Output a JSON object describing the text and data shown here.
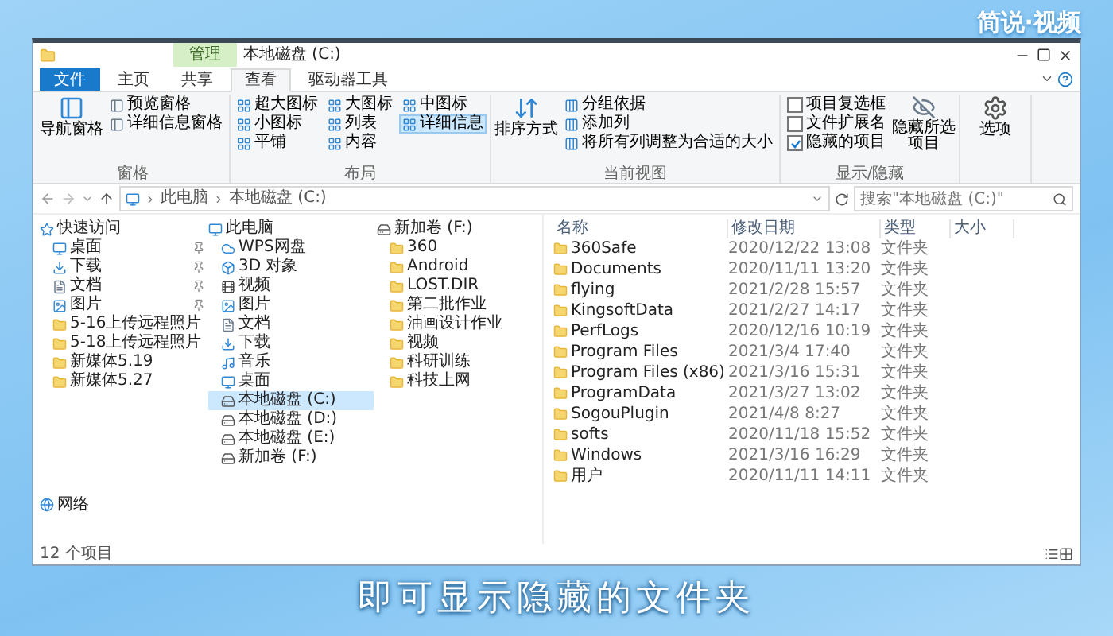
{
  "brand": {
    "logo": "简说·视频"
  },
  "window": {
    "title": "本地磁盘 (C:)",
    "context_tab": "管理"
  },
  "tabs": [
    {
      "label": "文件",
      "kind": "file",
      "selected": false
    },
    {
      "label": "主页",
      "kind": "tab",
      "selected": false
    },
    {
      "label": "共享",
      "kind": "tab",
      "selected": false
    },
    {
      "label": "查看",
      "kind": "tab",
      "selected": true
    },
    {
      "label": "驱动器工具",
      "kind": "tab",
      "selected": false
    }
  ],
  "ribbon": {
    "groups": [
      {
        "label": "窗格",
        "items": [
          {
            "label": "导航窗格",
            "kind": "large"
          },
          {
            "label": "预览窗格",
            "kind": "small"
          },
          {
            "label": "详细信息窗格",
            "kind": "small"
          }
        ]
      },
      {
        "label": "布局",
        "items": [
          {
            "label": "超大图标",
            "kind": "view",
            "selected": false
          },
          {
            "label": "小图标",
            "kind": "view",
            "selected": false
          },
          {
            "label": "平铺",
            "kind": "view",
            "selected": false
          },
          {
            "label": "大图标",
            "kind": "view",
            "selected": false
          },
          {
            "label": "列表",
            "kind": "view",
            "selected": false
          },
          {
            "label": "内容",
            "kind": "view",
            "selected": false
          },
          {
            "label": "中图标",
            "kind": "view",
            "selected": false
          },
          {
            "label": "详细信息",
            "kind": "view",
            "selected": true
          }
        ]
      },
      {
        "label": "当前视图",
        "items": [
          {
            "label": "排序方式",
            "kind": "large"
          },
          {
            "label": "分组依据",
            "kind": "small"
          },
          {
            "label": "添加列",
            "kind": "small"
          },
          {
            "label": "将所有列调整为合适的大小",
            "kind": "small"
          }
        ]
      },
      {
        "label": "显示/隐藏",
        "items": [
          {
            "label": "项目复选框",
            "kind": "check",
            "checked": false
          },
          {
            "label": "文件扩展名",
            "kind": "check",
            "checked": false
          },
          {
            "label": "隐藏的项目",
            "kind": "check",
            "checked": true
          },
          {
            "label": "隐藏所选项目",
            "kind": "large"
          }
        ]
      },
      {
        "items": [
          {
            "label": "选项",
            "kind": "large"
          }
        ]
      }
    ]
  },
  "address": {
    "path": [
      "此电脑",
      "本地磁盘 (C:)"
    ],
    "search_placeholder": "搜索\"本地磁盘 (C:)\""
  },
  "navigation": [
    {
      "label": "快速访问",
      "kind": "star",
      "selected": false,
      "children": [
        {
          "label": "桌面",
          "kind": "desktop",
          "pinned": true,
          "selected": false
        },
        {
          "label": "下载",
          "kind": "download",
          "pinned": true,
          "selected": false
        },
        {
          "label": "文档",
          "kind": "doc",
          "pinned": true,
          "selected": false
        },
        {
          "label": "图片",
          "kind": "picture",
          "pinned": true,
          "selected": false
        },
        {
          "label": "5-16上传远程照片",
          "kind": "folder",
          "pinned": false,
          "selected": false
        },
        {
          "label": "5-18上传远程照片",
          "kind": "folder",
          "pinned": false,
          "selected": false
        },
        {
          "label": "新媒体5.19",
          "kind": "folder",
          "pinned": false,
          "selected": false
        },
        {
          "label": "新媒体5.27",
          "kind": "folder",
          "pinned": false,
          "selected": false
        }
      ]
    },
    {
      "label": "此电脑",
      "kind": "pc",
      "selected": false,
      "children": [
        {
          "label": "WPS网盘",
          "kind": "cloud",
          "pinned": false,
          "selected": false
        },
        {
          "label": "3D 对象",
          "kind": "cube",
          "pinned": false,
          "selected": false
        },
        {
          "label": "视频",
          "kind": "video",
          "pinned": false,
          "selected": false
        },
        {
          "label": "图片",
          "kind": "picture",
          "pinned": false,
          "selected": false
        },
        {
          "label": "文档",
          "kind": "doc",
          "pinned": false,
          "selected": false
        },
        {
          "label": "下载",
          "kind": "download",
          "pinned": false,
          "selected": false
        },
        {
          "label": "音乐",
          "kind": "music",
          "pinned": false,
          "selected": false
        },
        {
          "label": "桌面",
          "kind": "desktop",
          "pinned": false,
          "selected": false
        },
        {
          "label": "本地磁盘 (C:)",
          "kind": "drive",
          "pinned": false,
          "selected": true
        },
        {
          "label": "本地磁盘 (D:)",
          "kind": "drive",
          "pinned": false,
          "selected": false
        },
        {
          "label": "本地磁盘 (E:)",
          "kind": "drive",
          "pinned": false,
          "selected": false
        },
        {
          "label": "新加卷 (F:)",
          "kind": "drive",
          "pinned": false,
          "selected": false
        }
      ]
    },
    {
      "label": "新加卷 (F:)",
      "kind": "drive",
      "selected": false,
      "children": [
        {
          "label": "360",
          "kind": "folder",
          "pinned": false,
          "selected": false
        },
        {
          "label": "Android",
          "kind": "folder",
          "pinned": false,
          "selected": false
        },
        {
          "label": "LOST.DIR",
          "kind": "folder",
          "pinned": false,
          "selected": false
        },
        {
          "label": "第二批作业",
          "kind": "folder",
          "pinned": false,
          "selected": false
        },
        {
          "label": "油画设计作业",
          "kind": "folder",
          "pinned": false,
          "selected": false
        },
        {
          "label": "视频",
          "kind": "folder",
          "pinned": false,
          "selected": false
        },
        {
          "label": "科研训练",
          "kind": "folder",
          "pinned": false,
          "selected": false
        },
        {
          "label": "科技上网",
          "kind": "folder",
          "pinned": false,
          "selected": false
        }
      ]
    },
    {
      "label": "网络",
      "kind": "network",
      "selected": false
    }
  ],
  "table": {
    "columns": [
      "名称",
      "修改日期",
      "类型",
      "大小"
    ],
    "rows": [
      {
        "name": "360Safe",
        "modified": "2020/12/22 13:08",
        "type": "文件夹"
      },
      {
        "name": "Documents",
        "modified": "2020/11/11 13:20",
        "type": "文件夹"
      },
      {
        "name": "flying",
        "modified": "2021/2/28 15:57",
        "type": "文件夹"
      },
      {
        "name": "KingsoftData",
        "modified": "2021/2/27 14:17",
        "type": "文件夹"
      },
      {
        "name": "PerfLogs",
        "modified": "2020/12/16 10:19",
        "type": "文件夹"
      },
      {
        "name": "Program Files",
        "modified": "2021/3/4 17:40",
        "type": "文件夹"
      },
      {
        "name": "Program Files (x86)",
        "modified": "2021/3/16 15:31",
        "type": "文件夹"
      },
      {
        "name": "ProgramData",
        "modified": "2021/3/27 13:02",
        "type": "文件夹"
      },
      {
        "name": "SogouPlugin",
        "modified": "2021/4/8 8:27",
        "type": "文件夹"
      },
      {
        "name": "softs",
        "modified": "2020/11/18 15:52",
        "type": "文件夹"
      },
      {
        "name": "Windows",
        "modified": "2021/3/16 16:29",
        "type": "文件夹"
      },
      {
        "name": "用户",
        "modified": "2020/11/11 14:11",
        "type": "文件夹"
      }
    ]
  },
  "status_bar": "12 个项目",
  "subtitle": "即可显示隐藏的文件夹"
}
